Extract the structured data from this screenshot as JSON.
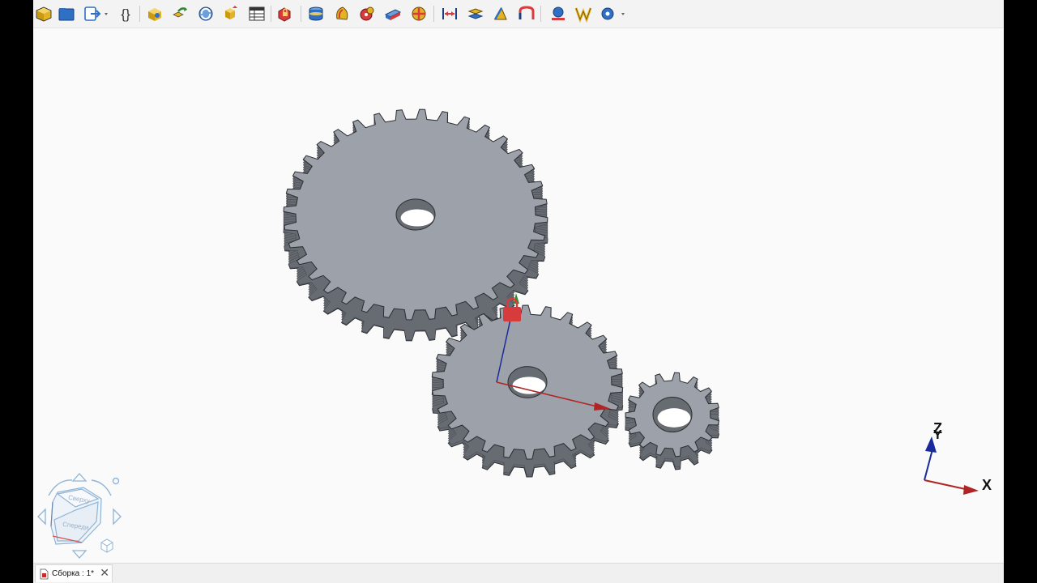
{
  "toolbar": {
    "items": [
      {
        "name": "add-part-icon"
      },
      {
        "name": "open-folder-icon"
      },
      {
        "name": "import-icon"
      },
      {
        "name": "variables-icon"
      },
      {
        "name": "insert-part-icon"
      },
      {
        "name": "insert-link-icon"
      },
      {
        "name": "update-icon"
      },
      {
        "name": "configuration-icon"
      },
      {
        "name": "parts-list-icon"
      },
      {
        "name": "fixed-constraint-icon"
      },
      {
        "name": "coincident-constraint-icon"
      },
      {
        "name": "rotation-constraint-icon"
      },
      {
        "name": "gear-joint-icon"
      },
      {
        "name": "slider-joint-icon"
      },
      {
        "name": "ball-joint-icon"
      },
      {
        "name": "distance-constraint-icon"
      },
      {
        "name": "parallel-constraint-icon"
      },
      {
        "name": "angle-constraint-icon"
      },
      {
        "name": "rack-pinion-icon"
      },
      {
        "name": "animate-icon"
      },
      {
        "name": "explode-icon"
      },
      {
        "name": "solver-settings-icon"
      }
    ]
  },
  "navcube": {
    "top_face": "Сверху",
    "front_face": "Спереди"
  },
  "axes": {
    "x": "X",
    "y": "Y",
    "z": "Z"
  },
  "tab": {
    "label": "Сборка : 1*",
    "close": "✕"
  },
  "colors": {
    "gear_face": "#9da2aa",
    "gear_side": "#676b72",
    "gear_edge": "#2b2d31",
    "axis_x": "#b12424",
    "axis_y": "#2d8a2d",
    "axis_z": "#1b2a9a",
    "lock": "#d83b3b",
    "background": "#fafafa"
  }
}
